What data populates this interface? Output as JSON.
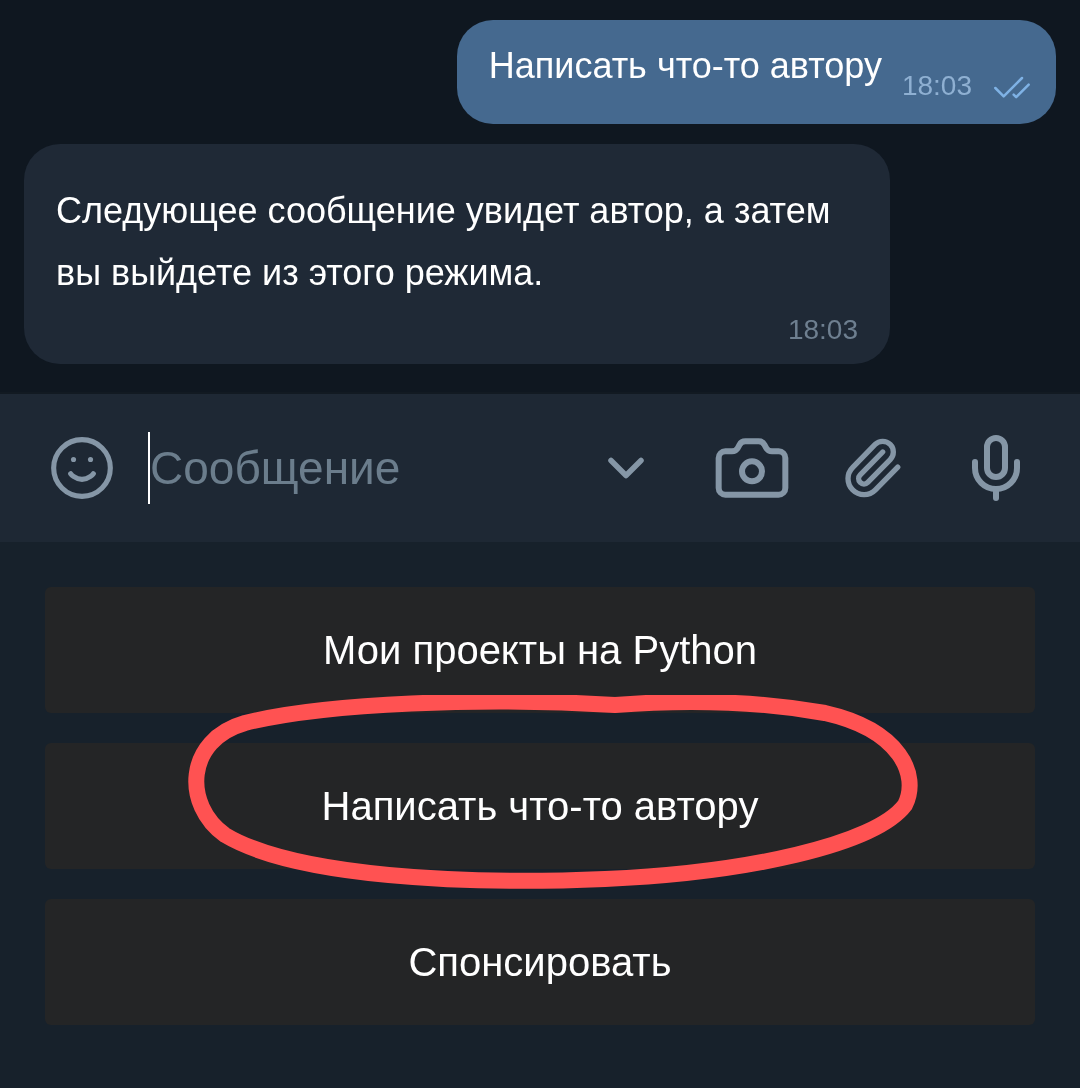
{
  "messages": [
    {
      "kind": "outgoing",
      "text": "Написать что-то автору",
      "time": "18:03",
      "read": true
    },
    {
      "kind": "incoming",
      "text": "Следующее сообщение увидет автор, а затем вы выйдете из этого режима.",
      "time": "18:03"
    }
  ],
  "composer": {
    "placeholder": "Сообщение",
    "focused": true
  },
  "keyboard": [
    {
      "label": "Мои проекты на Python",
      "highlighted": false
    },
    {
      "label": "Написать что-то автору",
      "highlighted": true
    },
    {
      "label": "Спонсировать",
      "highlighted": false
    }
  ]
}
